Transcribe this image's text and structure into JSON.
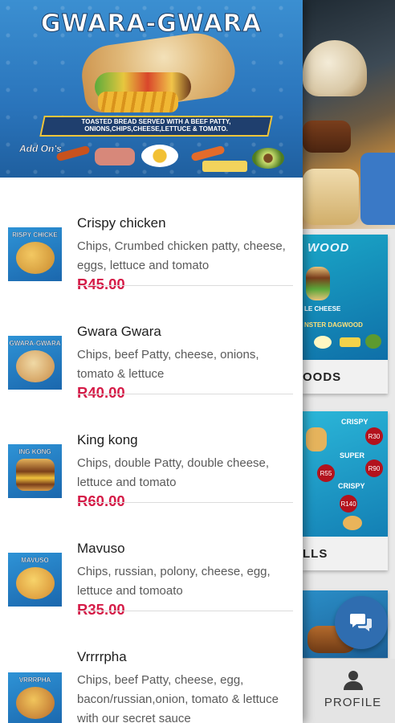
{
  "background": {
    "card1_caption": "OODS",
    "card1_banner": "WOOD",
    "card1_lines": [
      "LE CHEESE",
      "NSTER DAGWOOD"
    ],
    "card2_caption": "LLS",
    "card2_prices": [
      "R30",
      "R55",
      "R90",
      "R140"
    ],
    "card2_labels": [
      "CRISPY",
      "SUPER",
      "CRISPY"
    ],
    "bottom_nav": {
      "profile_label": "PROFILE",
      "profile_icon": "person-icon"
    },
    "chat_icon": "chat-bubbles-icon"
  },
  "drawer": {
    "hero": {
      "title": "GWARA-GWARA",
      "subtitle": "TOASTED BREAD SERVED WITH A BEEF PATTY, ONIONS,CHIPS,CHEESE,LETTUCE & TOMATO.",
      "addons_label": "Add On's"
    },
    "items": [
      {
        "name": "Crispy chicken",
        "description": "Chips, Crumbed chicken patty, cheese, eggs, lettuce and tomato",
        "price": "R45.00",
        "thumb_title": "RISPY CHICKE"
      },
      {
        "name": "Gwara Gwara",
        "description": "Chips, beef Patty, cheese, onions, tomato & lettuce",
        "price": "R40.00",
        "thumb_title": "GWARA-GWARA"
      },
      {
        "name": "King kong",
        "description": "Chips, double Patty, double cheese, lettuce and tomato",
        "price": "R60.00",
        "thumb_title": "ING KONG"
      },
      {
        "name": "Mavuso",
        "description": "Chips, russian, polony, cheese, egg, lettuce and tomoato",
        "price": "R35.00",
        "thumb_title": "MAVUSO"
      },
      {
        "name": "Vrrrrpha",
        "description": "Chips, beef Patty, cheese, egg, bacon/russian,onion, tomato & lettuce with our secret sauce",
        "price": "",
        "thumb_title": "VRRRPHA"
      }
    ]
  },
  "colors": {
    "price": "#d51b47",
    "hero_blue": "#2a74bb",
    "fab_blue": "#2f6db0"
  }
}
